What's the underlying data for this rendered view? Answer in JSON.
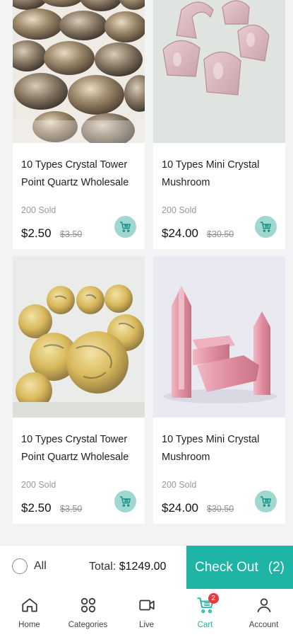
{
  "products": [
    {
      "title": "10 Types Crystal Tower Point Quartz Wholesale",
      "sold": "200 Sold",
      "price": "$2.50",
      "old_price": "$3.50",
      "image": "smoky-quartz-tumbled-stones"
    },
    {
      "title": "10 Types Mini Crystal Mushroom",
      "sold": "200 Sold",
      "price": "$24.00",
      "old_price": "$30.50",
      "image": "rose-quartz-carvings"
    },
    {
      "title": "10 Types Crystal Tower Point Quartz Wholesale",
      "sold": "200 Sold",
      "price": "$2.50",
      "old_price": "$3.50",
      "image": "crazy-lace-agate-spheres"
    },
    {
      "title": "10 Types Mini Crystal Mushroom",
      "sold": "200 Sold",
      "price": "$24.00",
      "old_price": "$30.50",
      "image": "rose-quartz-towers"
    }
  ],
  "checkout": {
    "select_all_label": "All",
    "total_label": "Total:",
    "total_amount": "$1249.00",
    "checkout_label": "Check Out",
    "checkout_count": "(2)"
  },
  "tabs": [
    {
      "label": "Home",
      "icon": "home-icon"
    },
    {
      "label": "Categories",
      "icon": "categories-icon"
    },
    {
      "label": "Live",
      "icon": "live-camera-icon"
    },
    {
      "label": "Cart",
      "icon": "cart-icon",
      "active": true,
      "badge": "2"
    },
    {
      "label": "Account",
      "icon": "account-icon"
    }
  ],
  "colors": {
    "accent": "#1fb5a6",
    "cart_button": "#9fd8d1",
    "badge": "#e83a3a"
  }
}
